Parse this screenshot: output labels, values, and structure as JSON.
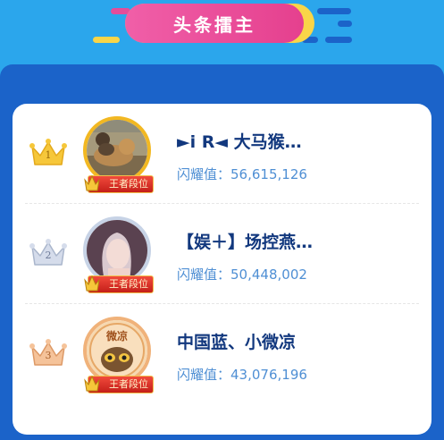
{
  "header": {
    "title": "头条擂主"
  },
  "ranking": {
    "entries": [
      {
        "rank": "1",
        "name": "►i R◄ 大马猴…",
        "score_label": "闪耀值：",
        "score": "56,615,126",
        "badge": "王者段位"
      },
      {
        "rank": "2",
        "name": "【娱＋】场控燕…",
        "score_label": "闪耀值：",
        "score": "50,448,002",
        "badge": "王者段位"
      },
      {
        "rank": "3",
        "name": "中国蓝、小微凉",
        "score_label": "闪耀值：",
        "score": "43,076,196",
        "badge": "王者段位"
      }
    ]
  },
  "avatar3_text": "微凉",
  "colors": {
    "background": "#2ba6ec",
    "panel": "#1b63c9",
    "title_banner": "#e5408e",
    "gold": "#f2b822",
    "silver": "#c7d3e6",
    "bronze": "#f0b27a",
    "name": "#12387e",
    "score": "#4f8fd4"
  },
  "icons": [
    "crown-gold-icon",
    "crown-silver-icon",
    "crown-bronze-icon",
    "rank-crown-icon"
  ]
}
